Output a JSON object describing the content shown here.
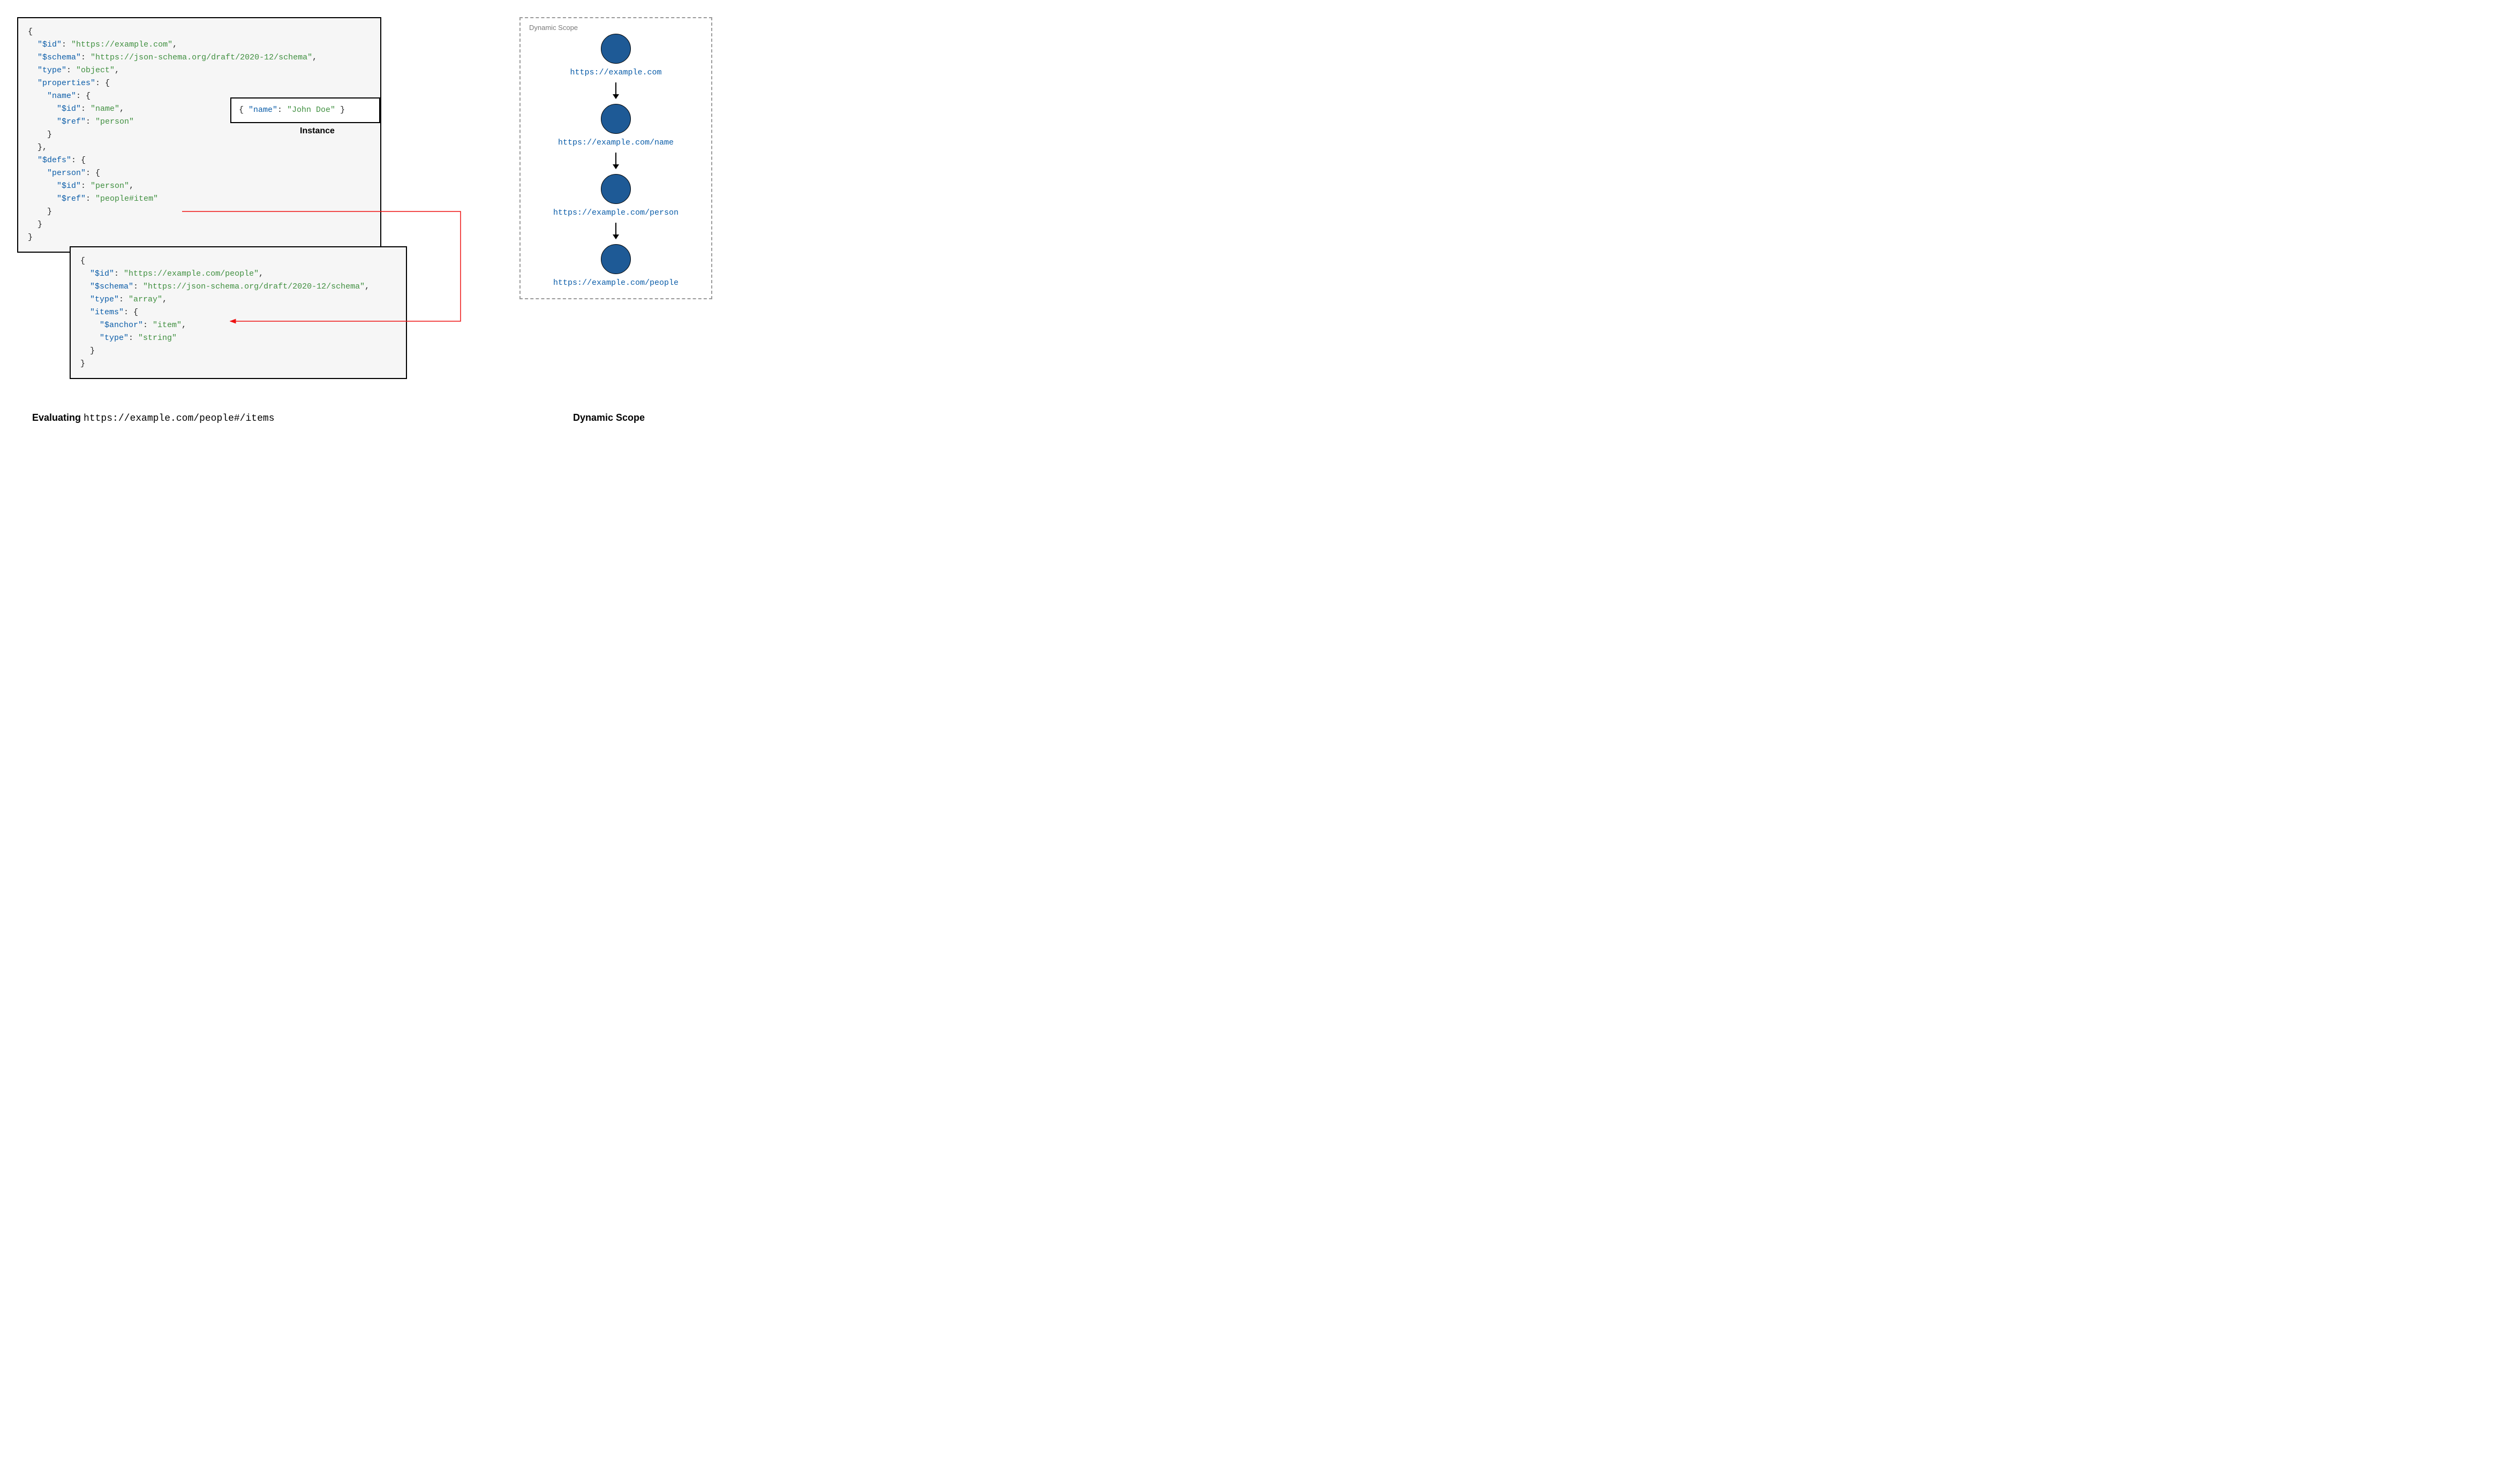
{
  "schema1": {
    "lines": [
      [
        {
          "cls": "p",
          "t": "{"
        }
      ],
      [
        {
          "cls": "p",
          "t": "  "
        },
        {
          "cls": "k",
          "t": "\"$id\""
        },
        {
          "cls": "p",
          "t": ": "
        },
        {
          "cls": "s",
          "t": "\"https://example.com\""
        },
        {
          "cls": "p",
          "t": ","
        }
      ],
      [
        {
          "cls": "p",
          "t": "  "
        },
        {
          "cls": "k",
          "t": "\"$schema\""
        },
        {
          "cls": "p",
          "t": ": "
        },
        {
          "cls": "s",
          "t": "\"https://json-schema.org/draft/2020-12/schema\""
        },
        {
          "cls": "p",
          "t": ","
        }
      ],
      [
        {
          "cls": "p",
          "t": "  "
        },
        {
          "cls": "k",
          "t": "\"type\""
        },
        {
          "cls": "p",
          "t": ": "
        },
        {
          "cls": "s",
          "t": "\"object\""
        },
        {
          "cls": "p",
          "t": ","
        }
      ],
      [
        {
          "cls": "p",
          "t": "  "
        },
        {
          "cls": "k",
          "t": "\"properties\""
        },
        {
          "cls": "p",
          "t": ": {"
        }
      ],
      [
        {
          "cls": "p",
          "t": "    "
        },
        {
          "cls": "k",
          "t": "\"name\""
        },
        {
          "cls": "p",
          "t": ": {"
        }
      ],
      [
        {
          "cls": "p",
          "t": "      "
        },
        {
          "cls": "k",
          "t": "\"$id\""
        },
        {
          "cls": "p",
          "t": ": "
        },
        {
          "cls": "s",
          "t": "\"name\""
        },
        {
          "cls": "p",
          "t": ","
        }
      ],
      [
        {
          "cls": "p",
          "t": "      "
        },
        {
          "cls": "k",
          "t": "\"$ref\""
        },
        {
          "cls": "p",
          "t": ": "
        },
        {
          "cls": "s",
          "t": "\"person\""
        }
      ],
      [
        {
          "cls": "p",
          "t": "    }"
        }
      ],
      [
        {
          "cls": "p",
          "t": "  },"
        }
      ],
      [
        {
          "cls": "p",
          "t": "  "
        },
        {
          "cls": "k",
          "t": "\"$defs\""
        },
        {
          "cls": "p",
          "t": ": {"
        }
      ],
      [
        {
          "cls": "p",
          "t": "    "
        },
        {
          "cls": "k",
          "t": "\"person\""
        },
        {
          "cls": "p",
          "t": ": {"
        }
      ],
      [
        {
          "cls": "p",
          "t": "      "
        },
        {
          "cls": "k",
          "t": "\"$id\""
        },
        {
          "cls": "p",
          "t": ": "
        },
        {
          "cls": "s",
          "t": "\"person\""
        },
        {
          "cls": "p",
          "t": ","
        }
      ],
      [
        {
          "cls": "p",
          "t": "      "
        },
        {
          "cls": "k",
          "t": "\"$ref\""
        },
        {
          "cls": "p",
          "t": ": "
        },
        {
          "cls": "s",
          "t": "\"people#item\""
        }
      ],
      [
        {
          "cls": "p",
          "t": "    }"
        }
      ],
      [
        {
          "cls": "p",
          "t": "  }"
        }
      ],
      [
        {
          "cls": "p",
          "t": "}"
        }
      ]
    ]
  },
  "instance": {
    "lines": [
      [
        {
          "cls": "p",
          "t": "{ "
        },
        {
          "cls": "k",
          "t": "\"name\""
        },
        {
          "cls": "p",
          "t": ": "
        },
        {
          "cls": "s",
          "t": "\"John Doe\""
        },
        {
          "cls": "p",
          "t": " }"
        }
      ]
    ],
    "label": "Instance"
  },
  "schema2": {
    "lines": [
      [
        {
          "cls": "p",
          "t": "{"
        }
      ],
      [
        {
          "cls": "p",
          "t": "  "
        },
        {
          "cls": "k",
          "t": "\"$id\""
        },
        {
          "cls": "p",
          "t": ": "
        },
        {
          "cls": "s",
          "t": "\"https://example.com/people\""
        },
        {
          "cls": "p",
          "t": ","
        }
      ],
      [
        {
          "cls": "p",
          "t": "  "
        },
        {
          "cls": "k",
          "t": "\"$schema\""
        },
        {
          "cls": "p",
          "t": ": "
        },
        {
          "cls": "s",
          "t": "\"https://json-schema.org/draft/2020-12/schema\""
        },
        {
          "cls": "p",
          "t": ","
        }
      ],
      [
        {
          "cls": "p",
          "t": "  "
        },
        {
          "cls": "k",
          "t": "\"type\""
        },
        {
          "cls": "p",
          "t": ": "
        },
        {
          "cls": "s",
          "t": "\"array\""
        },
        {
          "cls": "p",
          "t": ","
        }
      ],
      [
        {
          "cls": "p",
          "t": "  "
        },
        {
          "cls": "k",
          "t": "\"items\""
        },
        {
          "cls": "p",
          "t": ": {"
        }
      ],
      [
        {
          "cls": "p",
          "t": "    "
        },
        {
          "cls": "k",
          "t": "\"$anchor\""
        },
        {
          "cls": "p",
          "t": ": "
        },
        {
          "cls": "s",
          "t": "\"item\""
        },
        {
          "cls": "p",
          "t": ","
        }
      ],
      [
        {
          "cls": "p",
          "t": "    "
        },
        {
          "cls": "k",
          "t": "\"type\""
        },
        {
          "cls": "p",
          "t": ": "
        },
        {
          "cls": "s",
          "t": "\"string\""
        }
      ],
      [
        {
          "cls": "p",
          "t": "  }"
        }
      ],
      [
        {
          "cls": "p",
          "t": "}"
        }
      ]
    ]
  },
  "scope": {
    "title": "Dynamic Scope",
    "nodes": [
      "https://example.com",
      "https://example.com/name",
      "https://example.com/person",
      "https://example.com/people"
    ]
  },
  "captions": {
    "left_bold": "Evaluating ",
    "left_mono": "https://example.com/people#/items",
    "right": "Dynamic Scope"
  }
}
